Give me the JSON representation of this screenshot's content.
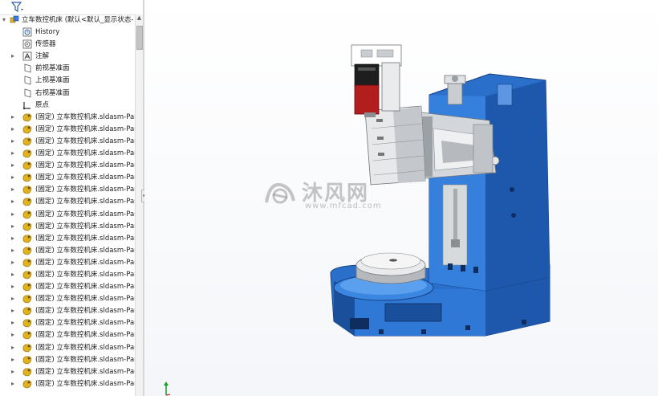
{
  "feature_tree": {
    "root_label": "立车数控机床  (默认<默认_显示状态-",
    "fixed_items": [
      {
        "name": "tree-item-history",
        "icon": "history-icon",
        "label": "History",
        "expand": ""
      },
      {
        "name": "tree-item-sensors",
        "icon": "sensor-icon",
        "label": "传感器",
        "expand": ""
      },
      {
        "name": "tree-item-annotations",
        "icon": "annotation-icon",
        "label": "注解",
        "expand": "▸"
      },
      {
        "name": "tree-item-front-plane",
        "icon": "plane-icon",
        "label": "前视基准面",
        "expand": ""
      },
      {
        "name": "tree-item-top-plane",
        "icon": "plane-icon",
        "label": "上视基准面",
        "expand": ""
      },
      {
        "name": "tree-item-right-plane",
        "icon": "plane-icon",
        "label": "右视基准面",
        "expand": ""
      },
      {
        "name": "tree-item-origin",
        "icon": "origin-icon",
        "label": "原点",
        "expand": ""
      }
    ],
    "part_label": "(固定) 立车数控机床.sldasm-Part",
    "part_count": 23
  },
  "colors": {
    "machine_blue": "#2a6fc9",
    "machine_blue_dark": "#1a4f9c",
    "steel_gray": "#c9ccd0",
    "motor_red": "#b21d1d",
    "part_icon_yellow": "#e2b21c"
  },
  "watermark": {
    "cn_text": "沐风网",
    "url_text": "www.mfcad.com"
  }
}
